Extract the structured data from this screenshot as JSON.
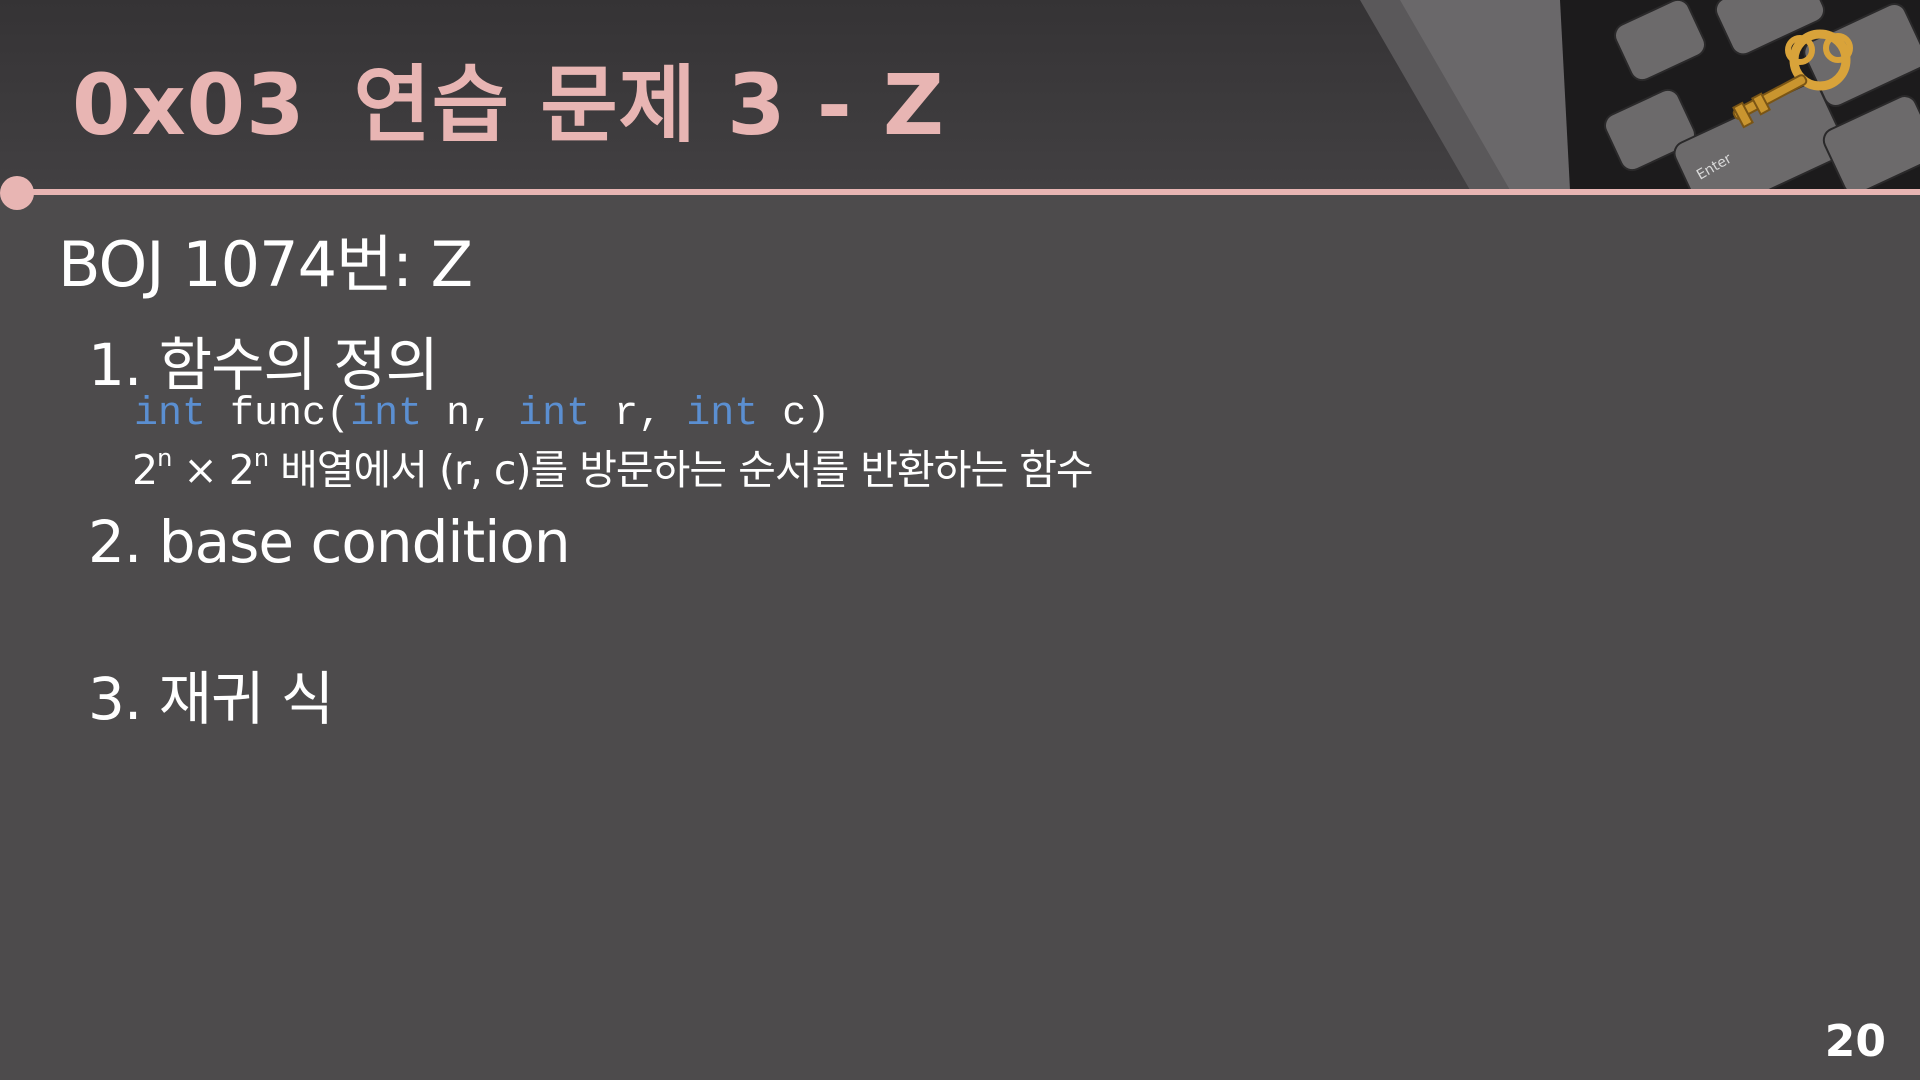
{
  "slide": {
    "title_number": "0x03",
    "title_text": "연습 문제 3 - Z",
    "problem_heading": "BOJ 1074번: Z",
    "items": [
      {
        "label": "1. 함수의 정의"
      },
      {
        "label": "2. base condition"
      },
      {
        "label": "3. 재귀 식"
      }
    ],
    "code": {
      "tokens": [
        "int",
        "func(",
        "int",
        "n,",
        "int",
        "r,",
        "int",
        "c)"
      ]
    },
    "description": {
      "base1": "2",
      "exp1": "n",
      "times": " × ",
      "base2": "2",
      "exp2": "n",
      "rest": " 배열에서 (r, c)를 방문하는 순서를 반환하는 함수"
    },
    "keyboard_key_label": "Enter",
    "page_number": "20"
  },
  "colors": {
    "accent": "#e8b5b3",
    "background": "#4d4b4c",
    "header": "#3a383a",
    "keyword": "#5b8fd1",
    "text": "#ffffff"
  },
  "icons": [
    "key-on-keyboard-image"
  ]
}
